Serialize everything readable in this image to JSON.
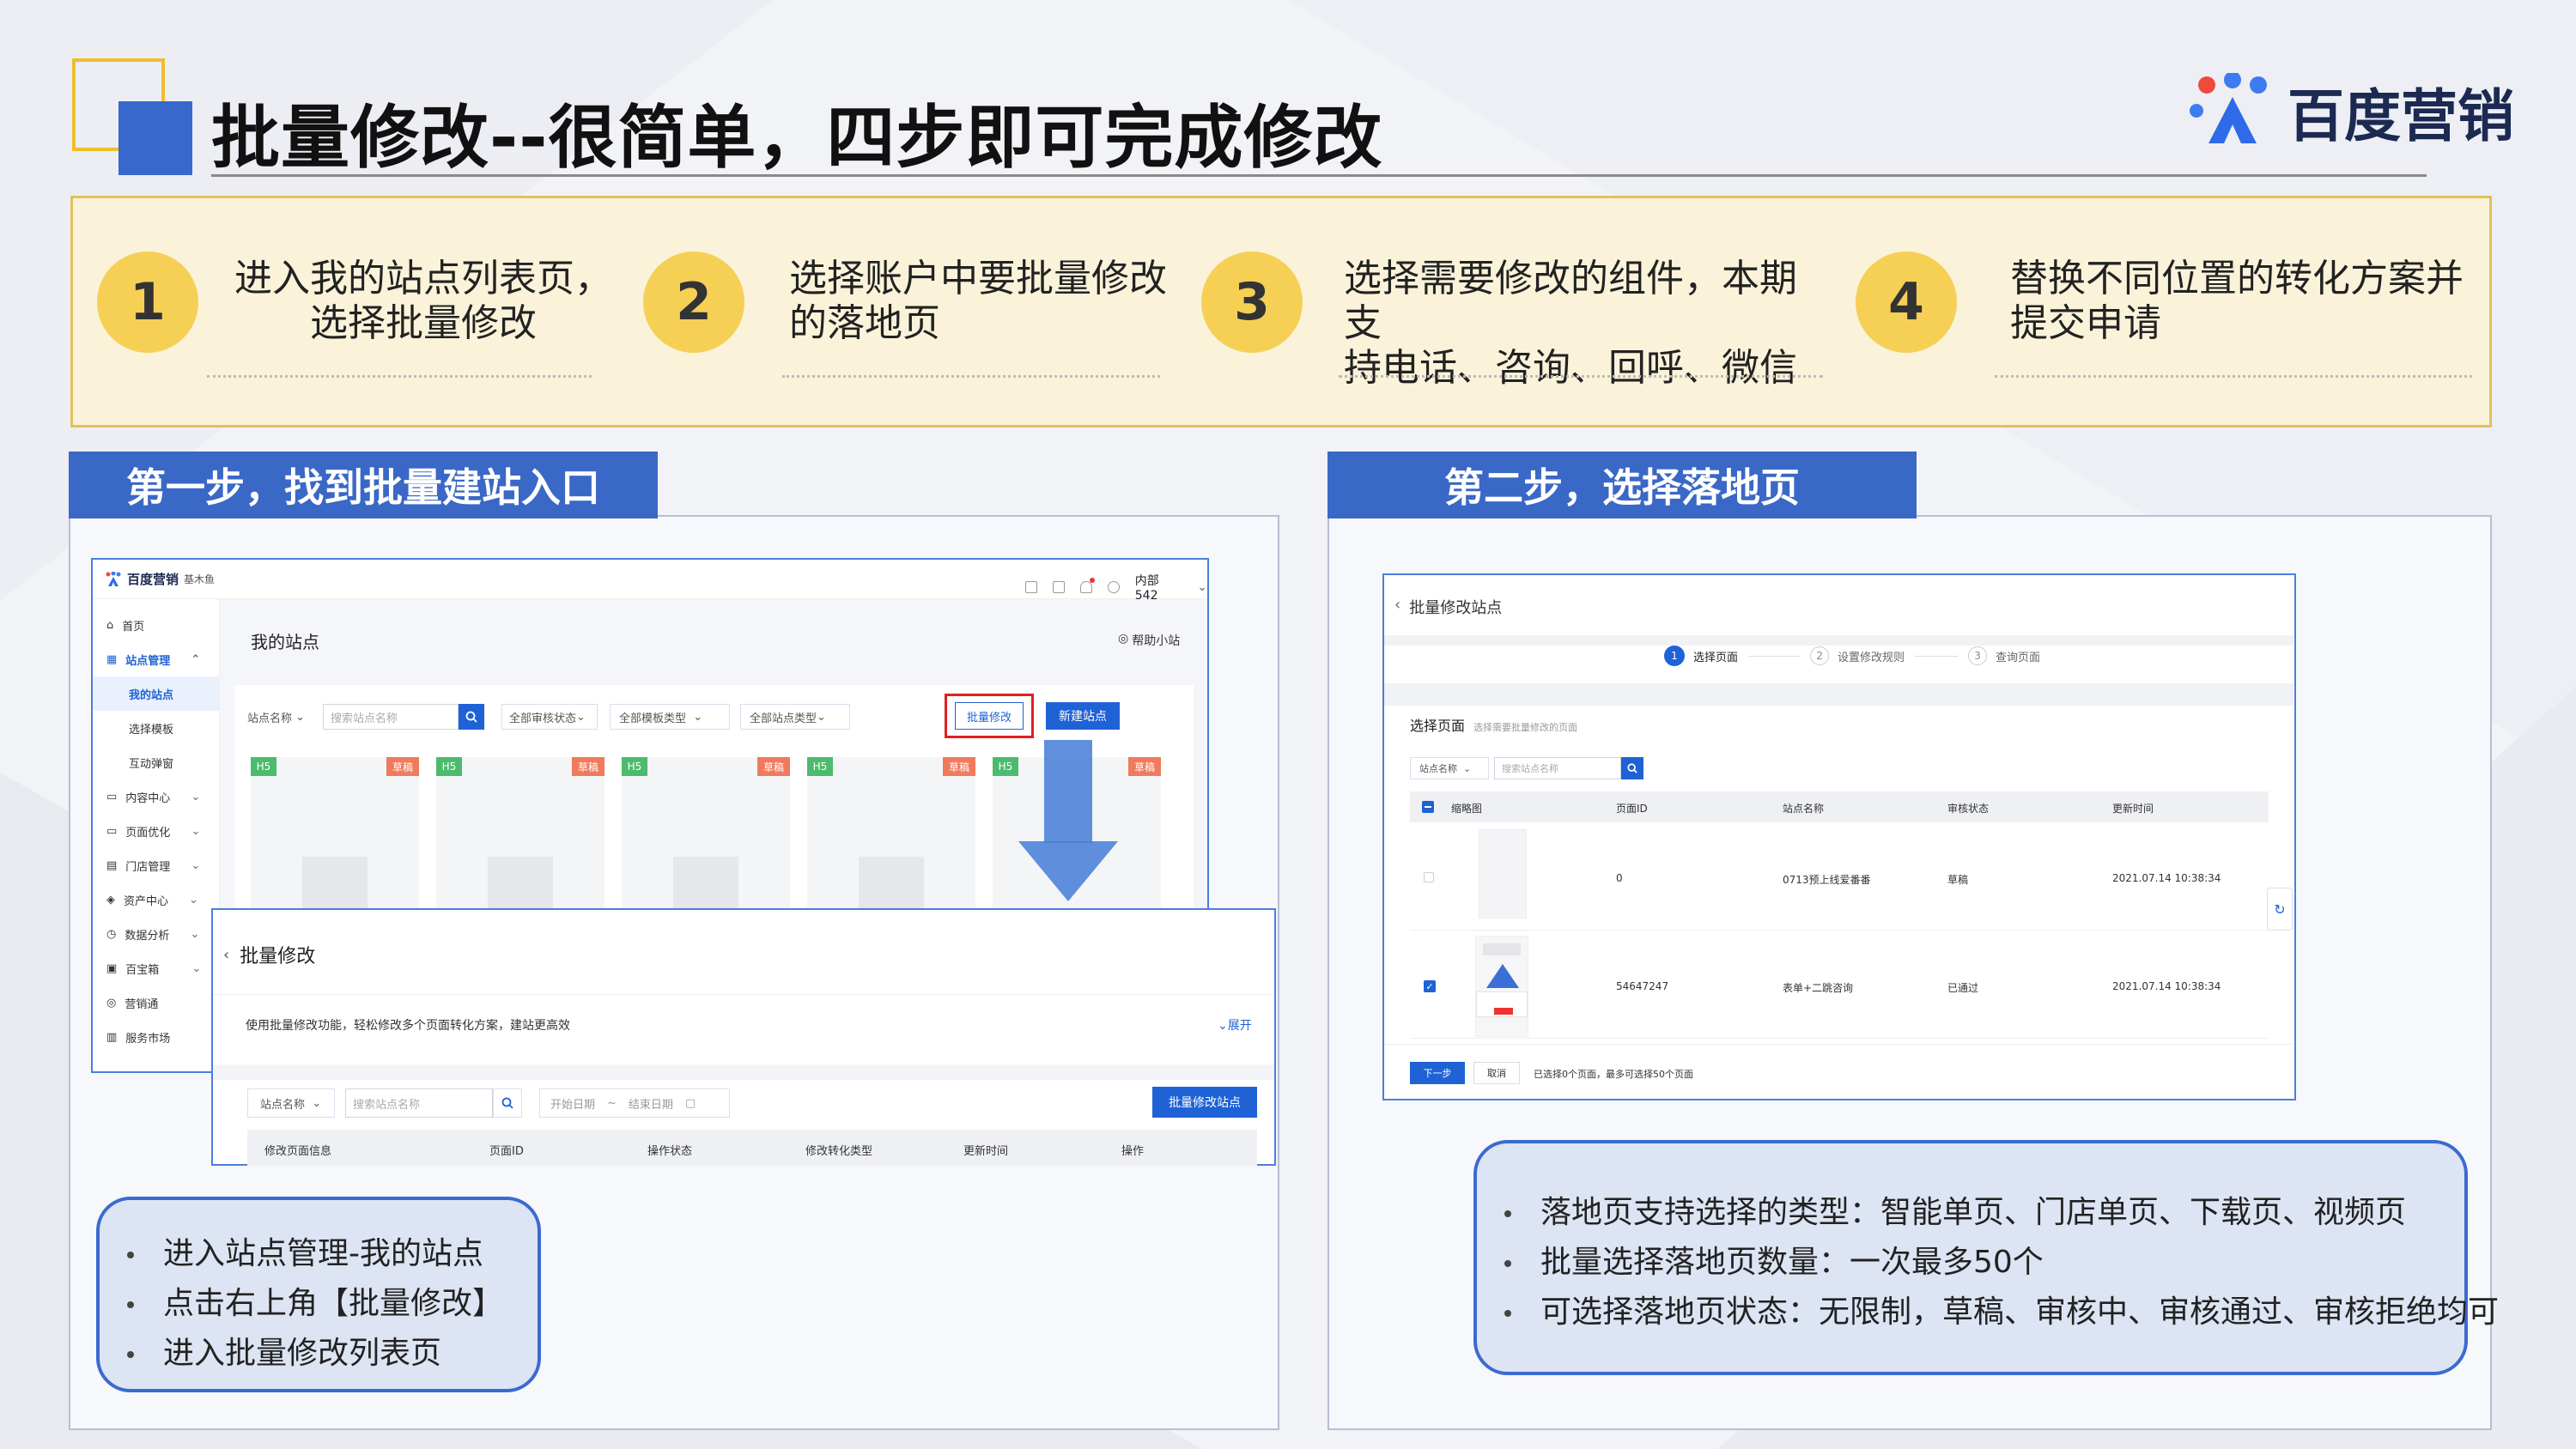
{
  "header": {
    "title": "批量修改--很简单，四步即可完成修改",
    "brand": "百度营销"
  },
  "steps": [
    {
      "num": "1",
      "line1": "进入我的站点列表页，",
      "line2": "选择批量修改"
    },
    {
      "num": "2",
      "line1": "选择账户中要批量修改",
      "line2": "的落地页"
    },
    {
      "num": "3",
      "line1": "选择需要修改的组件，本期支",
      "line2": "持电话、咨询、回呼、微信"
    },
    {
      "num": "4",
      "line1": "替换不同位置的转化方案并",
      "line2": "提交申请"
    }
  ],
  "step1": {
    "banner": "第一步，找到批量建站入口",
    "app": {
      "brand": "百度营销",
      "sub": "基木鱼",
      "account": "内部542",
      "page_title": "我的站点",
      "help": "帮助小站",
      "sidebar": [
        {
          "label": "首页",
          "icon": "home-icon"
        },
        {
          "label": "站点管理",
          "icon": "grid-icon"
        },
        {
          "label": "我的站点",
          "icon": ""
        },
        {
          "label": "选择模板",
          "icon": ""
        },
        {
          "label": "互动弹窗",
          "icon": ""
        },
        {
          "label": "内容中心",
          "icon": "content-icon"
        },
        {
          "label": "页面优化",
          "icon": "optimize-icon"
        },
        {
          "label": "门店管理",
          "icon": "store-icon"
        },
        {
          "label": "资产中心",
          "icon": "asset-icon"
        },
        {
          "label": "数据分析",
          "icon": "analytics-icon"
        },
        {
          "label": "百宝箱",
          "icon": "toolbox-icon"
        },
        {
          "label": "营销通",
          "icon": "marketing-icon"
        },
        {
          "label": "服务市场",
          "icon": "market-icon"
        }
      ],
      "filters": {
        "site_name": "站点名称",
        "search_placeholder": "搜索站点名称",
        "audit": "全部审核状态",
        "template": "全部模板类型",
        "site_type": "全部站点类型",
        "batch_btn": "批量修改",
        "new_btn": "新建站点"
      },
      "card_tags": {
        "h5": "H5",
        "draft": "草稿"
      }
    },
    "dialog": {
      "title": "批量修改",
      "desc": "使用批量修改功能，轻松修改多个页面转化方案，建站更高效",
      "expand": "展开",
      "site_name": "站点名称",
      "search_placeholder": "搜索站点名称",
      "start_date": "开始日期",
      "tilde": "~",
      "end_date": "结束日期",
      "batch_btn": "批量修改站点",
      "columns": [
        "修改页面信息",
        "页面ID",
        "操作状态",
        "修改转化类型",
        "更新时间",
        "操作"
      ]
    },
    "notes": [
      "进入站点管理-我的站点",
      "点击右上角【批量修改】",
      "进入批量修改列表页"
    ]
  },
  "step2": {
    "banner": "第二步，选择落地页",
    "window": {
      "title": "批量修改站点",
      "stepper": [
        {
          "n": "1",
          "label": "选择页面"
        },
        {
          "n": "2",
          "label": "设置修改规则"
        },
        {
          "n": "3",
          "label": "查询页面"
        }
      ],
      "section_title": "选择页面",
      "section_sub": "选择需要批量修改的页面",
      "site_name": "站点名称",
      "search_placeholder": "搜索站点名称",
      "columns": [
        "缩略图",
        "页面ID",
        "站点名称",
        "审核状态",
        "更新时间"
      ],
      "rows": [
        {
          "id": "0",
          "name": "0713预上线爱番番",
          "status": "草稿",
          "time": "2021.07.14 10:38:34",
          "checked": false
        },
        {
          "id": "54647247",
          "name": "表单+二跳咨询",
          "status": "已通过",
          "time": "2021.07.14 10:38:34",
          "checked": true
        }
      ],
      "next_btn": "下一步",
      "cancel_btn": "取消",
      "footer": "已选择0个页面，最多可选择50个页面"
    },
    "notes": [
      "落地页支持选择的类型：智能单页、门店单页、下载页、视频页",
      "批量选择落地页数量：一次最多50个",
      "可选择落地页状态：无限制，草稿、审核中、审核通过、审核拒绝均可"
    ]
  }
}
